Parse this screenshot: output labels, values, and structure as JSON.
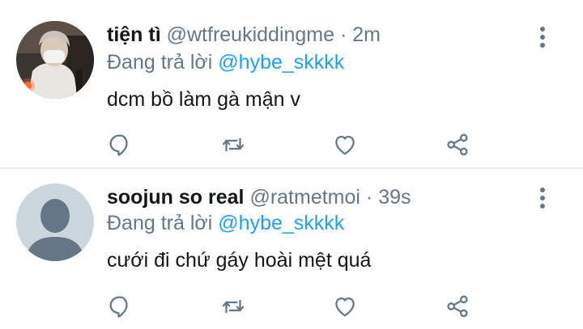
{
  "tweets": [
    {
      "display_name": "tiện tì",
      "handle": "@wtfreukiddingme",
      "separator": "·",
      "time": "2m",
      "reply_prefix": "Đang trả lời",
      "reply_to": "@hybe_skkkk",
      "text": "dcm bồ làm gà mận v",
      "avatar": "photo-avatar"
    },
    {
      "display_name": "soojun so real",
      "handle": "@ratmetmoi",
      "separator": "·",
      "time": "39s",
      "reply_prefix": "Đang trả lời",
      "reply_to": "@hybe_skkkk",
      "text": "cưới đi chứ gáy hoài mệt quá",
      "avatar": "default-avatar"
    }
  ],
  "icons": [
    "more-vertical-icon",
    "reply-icon",
    "retweet-icon",
    "like-icon",
    "share-icon"
  ],
  "colors": {
    "text": "#14171a",
    "secondary": "#657786",
    "mention": "#1da1f2",
    "divider": "#e6ecf0",
    "default_avatar_bg": "#ccd6dd",
    "default_avatar_fg": "#657786"
  }
}
